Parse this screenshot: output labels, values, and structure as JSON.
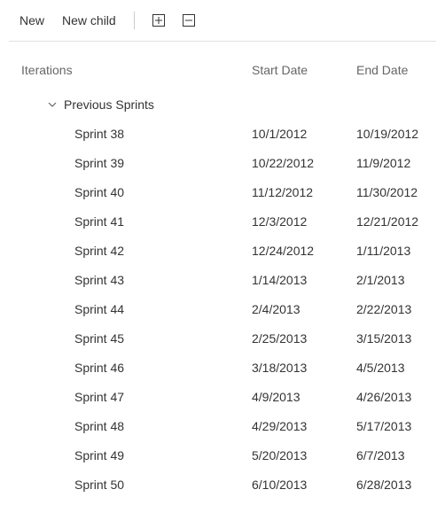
{
  "toolbar": {
    "new_label": "New",
    "new_child_label": "New child"
  },
  "columns": {
    "iterations": "Iterations",
    "start_date": "Start Date",
    "end_date": "End Date"
  },
  "group": {
    "label": "Previous Sprints",
    "items": [
      {
        "name": "Sprint 38",
        "start": "10/1/2012",
        "end": "10/19/2012"
      },
      {
        "name": "Sprint 39",
        "start": "10/22/2012",
        "end": "11/9/2012"
      },
      {
        "name": "Sprint 40",
        "start": "11/12/2012",
        "end": "11/30/2012"
      },
      {
        "name": "Sprint 41",
        "start": "12/3/2012",
        "end": "12/21/2012"
      },
      {
        "name": "Sprint 42",
        "start": "12/24/2012",
        "end": "1/11/2013"
      },
      {
        "name": "Sprint 43",
        "start": "1/14/2013",
        "end": "2/1/2013"
      },
      {
        "name": "Sprint 44",
        "start": "2/4/2013",
        "end": "2/22/2013"
      },
      {
        "name": "Sprint 45",
        "start": "2/25/2013",
        "end": "3/15/2013"
      },
      {
        "name": "Sprint 46",
        "start": "3/18/2013",
        "end": "4/5/2013"
      },
      {
        "name": "Sprint 47",
        "start": "4/9/2013",
        "end": "4/26/2013"
      },
      {
        "name": "Sprint 48",
        "start": "4/29/2013",
        "end": "5/17/2013"
      },
      {
        "name": "Sprint 49",
        "start": "5/20/2013",
        "end": "6/7/2013"
      },
      {
        "name": "Sprint 50",
        "start": "6/10/2013",
        "end": "6/28/2013"
      }
    ]
  }
}
